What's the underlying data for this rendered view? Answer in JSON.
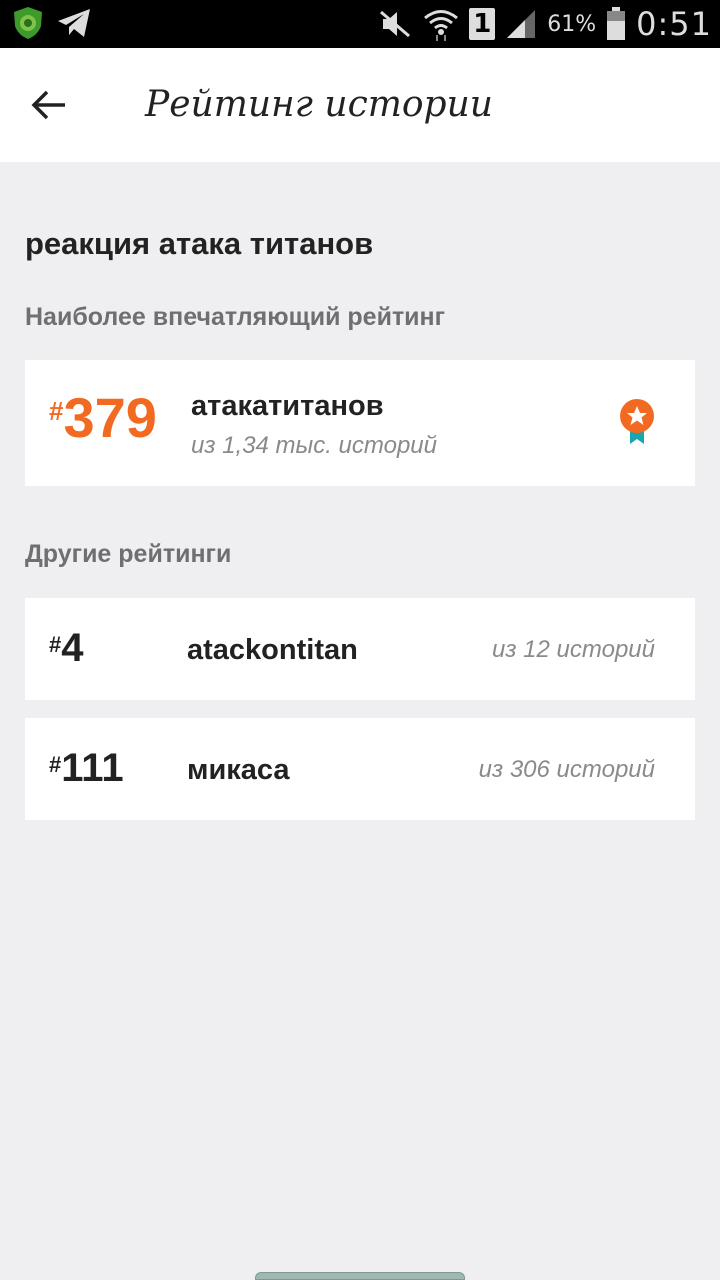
{
  "status_bar": {
    "battery_percent": "61%",
    "time": "0:51",
    "sim_number": "1"
  },
  "app_bar": {
    "title": "Рейтинг истории"
  },
  "story": {
    "title": "реакция атака титанов"
  },
  "best_ranking": {
    "section_label": "Наиболее впечатляющий рейтинг",
    "hash": "#",
    "rank": "379",
    "tag": "атакатитанов",
    "subtitle": "из 1,34 тыс. историй",
    "accent_color": "#f26a21"
  },
  "other_rankings": {
    "section_label": "Другие рейтинги",
    "items": [
      {
        "hash": "#",
        "rank": "4",
        "tag": "atackontitan",
        "subtitle": "из 12 историй"
      },
      {
        "hash": "#",
        "rank": "111",
        "tag": "микаса",
        "subtitle": "из 306 историй"
      }
    ]
  }
}
